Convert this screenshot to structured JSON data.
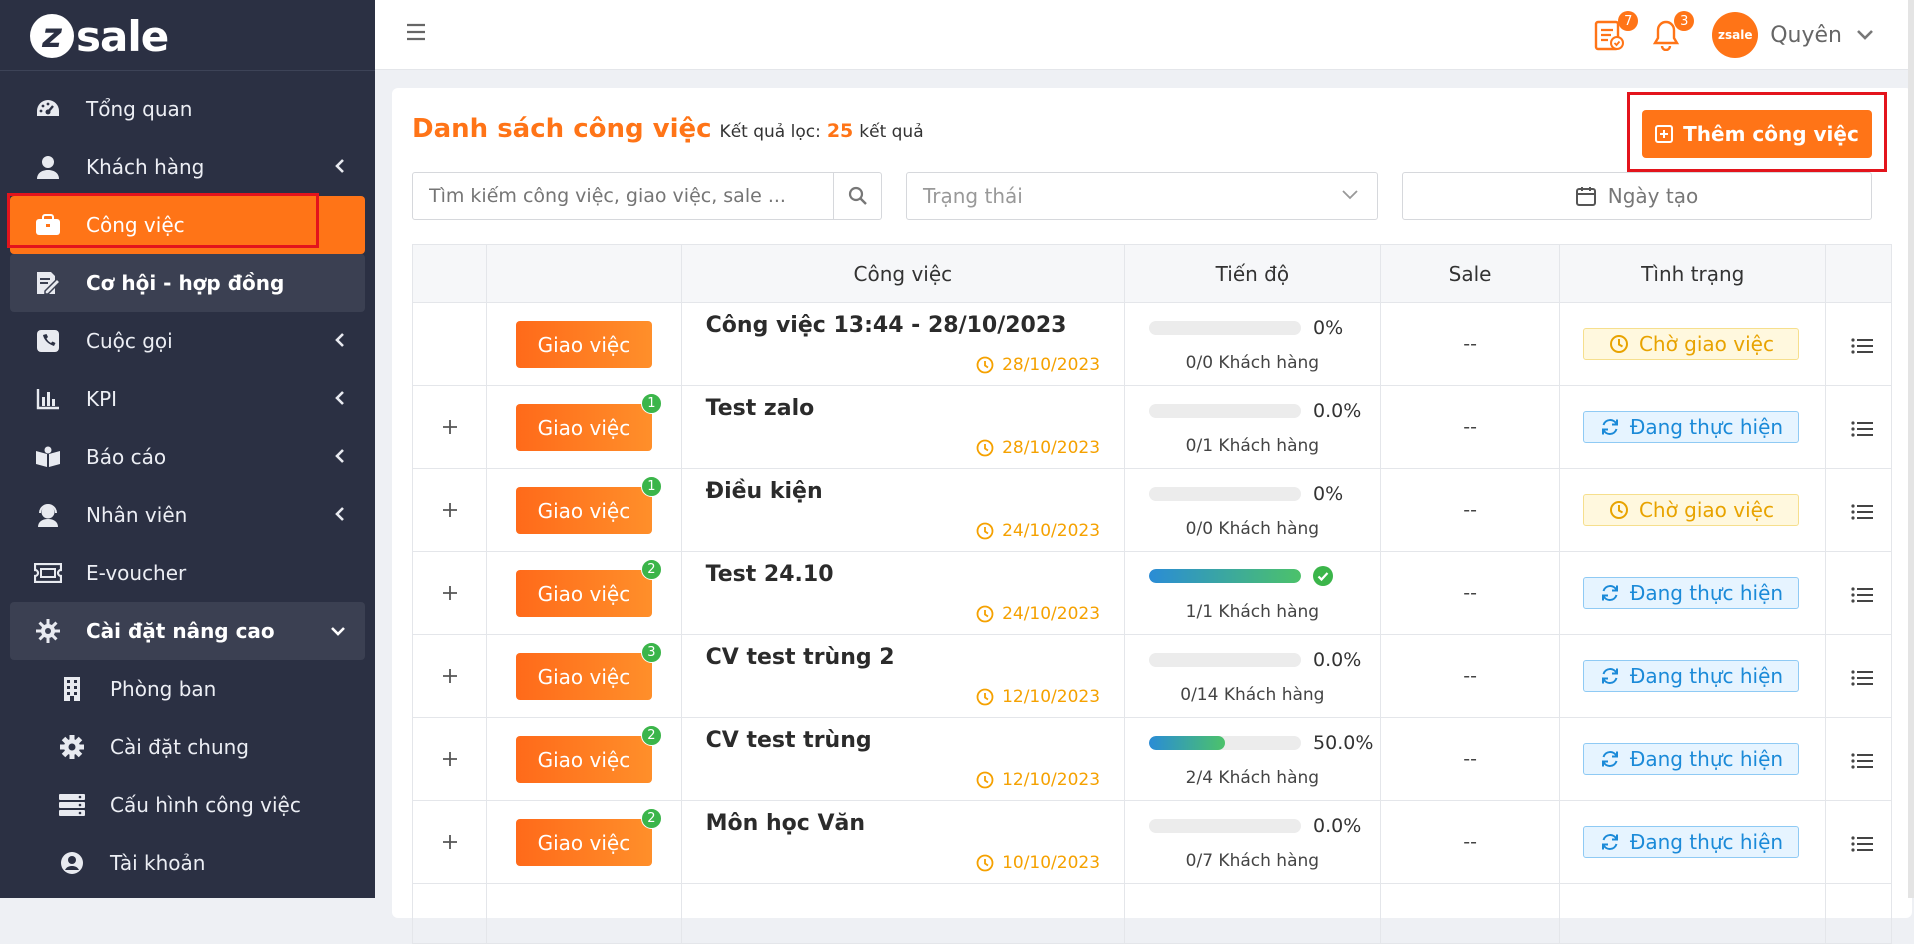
{
  "brand": {
    "logo_text": "sale",
    "logo_badge": "z"
  },
  "sidebar": {
    "items": [
      {
        "label": "Tổng quan",
        "icon": "dashboard-icon"
      },
      {
        "label": "Khách hàng",
        "icon": "user-icon"
      },
      {
        "label": "Công việc",
        "icon": "briefcase-icon"
      },
      {
        "label": "Cơ hội - hợp đồng",
        "icon": "contract-icon"
      },
      {
        "label": "Cuộc gọi",
        "icon": "phone-icon"
      },
      {
        "label": "KPI",
        "icon": "bar-chart-icon"
      },
      {
        "label": "Báo cáo",
        "icon": "report-icon"
      },
      {
        "label": "Nhân viên",
        "icon": "staff-icon"
      },
      {
        "label": "E-voucher",
        "icon": "ticket-icon"
      },
      {
        "label": "Cài đặt nâng cao",
        "icon": "settings-icon"
      },
      {
        "label": "Phòng ban",
        "icon": "building-icon"
      },
      {
        "label": "Cài đặt chung",
        "icon": "gear-icon"
      },
      {
        "label": "Cấu hình công việc",
        "icon": "server-icon"
      },
      {
        "label": "Tài khoản",
        "icon": "account-icon"
      }
    ]
  },
  "topbar": {
    "task_badge": "7",
    "notif_badge": "3",
    "avatar_text": "zsale",
    "user_name": "Quyên"
  },
  "page": {
    "title": "Danh sách công việc",
    "result_prefix": "Kết quả lọc:",
    "result_count": "25",
    "result_suffix": "kết quả",
    "add_button": "Thêm công việc"
  },
  "filters": {
    "search_placeholder": "Tìm kiếm công việc, giao việc, sale ...",
    "status_placeholder": "Trạng thái",
    "date_label": "Ngày tạo"
  },
  "table": {
    "columns": [
      "",
      "",
      "Công việc",
      "Tiến độ",
      "Sale",
      "Tình trạng",
      ""
    ],
    "assign_label": "Giao việc",
    "rows": [
      {
        "name": "Công việc 13:44 - 28/10/2023",
        "date": "28/10/2023",
        "progress": 0,
        "progress_text": "0%",
        "customers": "0/0 Khách hàng",
        "sale": "--",
        "status": "Chờ giao việc",
        "status_type": "wait",
        "badge": "",
        "expandable": false,
        "done": false
      },
      {
        "name": "Test zalo",
        "date": "28/10/2023",
        "progress": 0,
        "progress_text": "0.0%",
        "customers": "0/1 Khách hàng",
        "sale": "--",
        "status": "Đang thực hiện",
        "status_type": "doing",
        "badge": "1",
        "expandable": true,
        "done": false
      },
      {
        "name": "Điều kiện",
        "date": "24/10/2023",
        "progress": 0,
        "progress_text": "0%",
        "customers": "0/0 Khách hàng",
        "sale": "--",
        "status": "Chờ giao việc",
        "status_type": "wait",
        "badge": "1",
        "expandable": true,
        "done": false
      },
      {
        "name": "Test 24.10",
        "date": "24/10/2023",
        "progress": 100,
        "progress_text": "",
        "customers": "1/1 Khách hàng",
        "sale": "--",
        "status": "Đang thực hiện",
        "status_type": "doing",
        "badge": "2",
        "expandable": true,
        "done": true
      },
      {
        "name": "CV test trùng 2",
        "date": "12/10/2023",
        "progress": 0,
        "progress_text": "0.0%",
        "customers": "0/14 Khách hàng",
        "sale": "--",
        "status": "Đang thực hiện",
        "status_type": "doing",
        "badge": "3",
        "expandable": true,
        "done": false
      },
      {
        "name": "CV test trùng",
        "date": "12/10/2023",
        "progress": 50,
        "progress_text": "50.0%",
        "customers": "2/4 Khách hàng",
        "sale": "--",
        "status": "Đang thực hiện",
        "status_type": "doing",
        "badge": "2",
        "expandable": true,
        "done": false
      },
      {
        "name": "Môn học Văn",
        "date": "10/10/2023",
        "progress": 0,
        "progress_text": "0.0%",
        "customers": "0/7 Khách hàng",
        "sale": "--",
        "status": "Đang thực hiện",
        "status_type": "doing",
        "badge": "2",
        "expandable": true,
        "done": false
      },
      {
        "name": "",
        "date": "",
        "progress": 0,
        "progress_text": "",
        "customers": "",
        "sale": "",
        "status": "",
        "status_type": "",
        "badge": "",
        "expandable": false,
        "done": false
      }
    ]
  },
  "colors": {
    "accent": "#ff7417",
    "sidebar_bg": "#2b3043",
    "success": "#3bb54a",
    "wait": "#e8a300",
    "doing": "#1b8ad8",
    "highlight_frame": "#e3141c"
  }
}
